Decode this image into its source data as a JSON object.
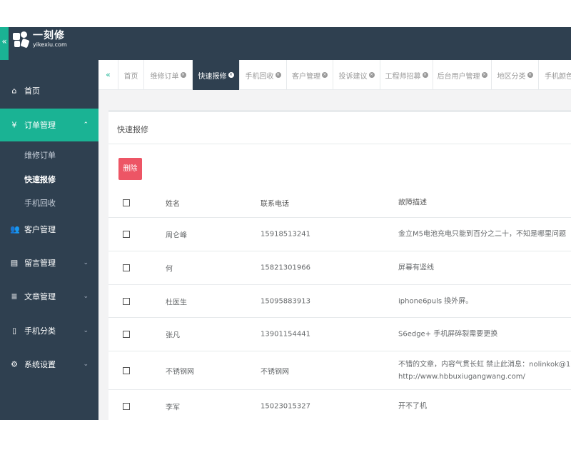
{
  "brand": {
    "title": "一刻修",
    "domain": "yikexiu.com",
    "collapse_glyph": "«"
  },
  "sidebar": {
    "items": [
      {
        "label": "首页",
        "icon": "home-icon",
        "glyph": "⌂"
      },
      {
        "label": "订单管理",
        "icon": "yen-icon",
        "glyph": "¥",
        "arrow": "⌃"
      },
      {
        "label": "客户管理",
        "icon": "users-icon",
        "glyph": "👥"
      },
      {
        "label": "留言管理",
        "icon": "list-icon",
        "glyph": "▤",
        "arrow": "⌄"
      },
      {
        "label": "文章管理",
        "icon": "align-icon",
        "glyph": "≣",
        "arrow": "⌄"
      },
      {
        "label": "手机分类",
        "icon": "mobile-icon",
        "glyph": "▯",
        "arrow": "⌄"
      },
      {
        "label": "系统设置",
        "icon": "gear-icon",
        "glyph": "⚙",
        "arrow": "⌄"
      }
    ],
    "subitems": [
      "维修订单",
      "快速报修",
      "手机回收"
    ]
  },
  "tabs": {
    "back_glyph": "«",
    "items": [
      "首页",
      "维修订单",
      "快速报修",
      "手机回收",
      "客户管理",
      "投诉建议",
      "工程师招募",
      "后台用户管理",
      "地区分类",
      "手机颜色"
    ],
    "close_glyph": "×"
  },
  "panel": {
    "title": "快速报修",
    "delete_label": "删除"
  },
  "table": {
    "headers": [
      "姓名",
      "联系电话",
      "故障描述"
    ],
    "rows": [
      {
        "name": "周仑峰",
        "phone": "15918513241",
        "desc": "金立M5电池充电只能到百分之二十，不知是哪里问题"
      },
      {
        "name": "何",
        "phone": "15821301966",
        "desc": "屏幕有竖线"
      },
      {
        "name": "杜医生",
        "phone": "15095883913",
        "desc": "iphone6puls 換外屏。"
      },
      {
        "name": "张凡",
        "phone": "13901154441",
        "desc": "S6edge+ 手机屏碎裂需要更换"
      },
      {
        "name": "不锈钢网",
        "phone": "不锈钢网",
        "desc": "不错的文章，内容气贯长虹 禁止此消息：nolinkok@163.com 不",
        "desc2": "http://www.hbbuxiugangwang.com/"
      },
      {
        "name": "李军",
        "phone": "15023015327",
        "desc": "开不了机"
      }
    ]
  },
  "colors": {
    "sidebar_bg": "#2f4050",
    "accent": "#1ab394",
    "danger": "#ed5565"
  }
}
